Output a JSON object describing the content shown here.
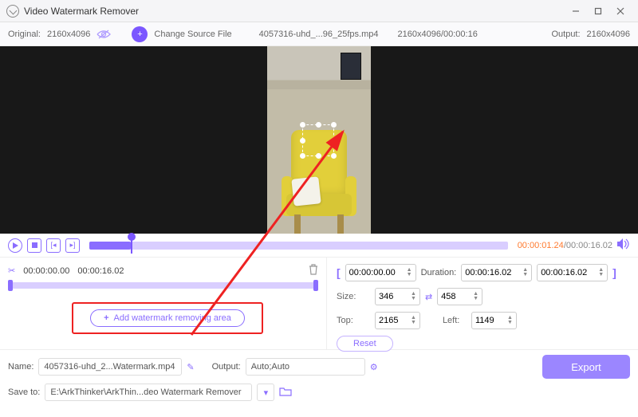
{
  "window": {
    "title": "Video Watermark Remover"
  },
  "infobar": {
    "original_label": "Original:",
    "original_res": "2160x4096",
    "change_source": "Change Source File",
    "filename": "4057316-uhd_...96_25fps.mp4",
    "file_res_time": "2160x4096/00:00:16",
    "output_label": "Output:",
    "output_res": "2160x4096"
  },
  "player": {
    "current": "00:00:01.24",
    "total": "00:00:16.02"
  },
  "clip": {
    "start": "00:00:00.00",
    "end": "00:00:16.02"
  },
  "add_area_label": "Add watermark removing area",
  "range": {
    "start": "00:00:00.00",
    "duration_label": "Duration:",
    "duration": "00:00:16.02",
    "end": "00:00:16.02"
  },
  "size": {
    "label": "Size:",
    "w": "346",
    "h": "458"
  },
  "pos": {
    "top_label": "Top:",
    "top": "2165",
    "left_label": "Left:",
    "left": "1149"
  },
  "reset_label": "Reset",
  "name": {
    "label": "Name:",
    "value": "4057316-uhd_2...Watermark.mp4"
  },
  "output_sel": {
    "label": "Output:",
    "value": "Auto;Auto"
  },
  "save": {
    "label": "Save to:",
    "value": "E:\\ArkThinker\\ArkThin...deo Watermark Remover"
  },
  "export_label": "Export"
}
